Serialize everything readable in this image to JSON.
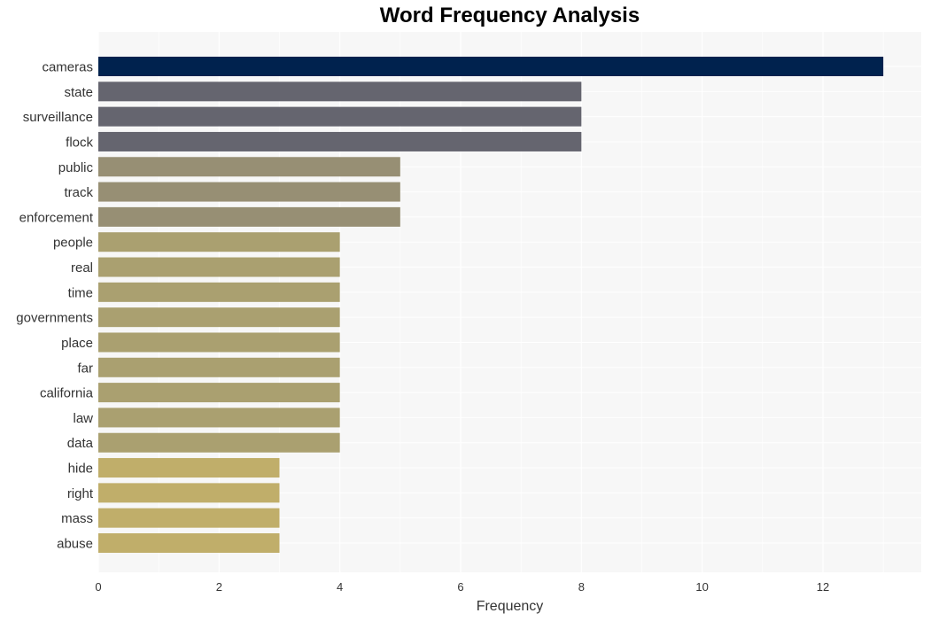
{
  "chart_data": {
    "type": "bar",
    "orientation": "horizontal",
    "title": "Word Frequency Analysis",
    "xlabel": "Frequency",
    "ylabel": "",
    "xlim": [
      0,
      13.6
    ],
    "xticks": [
      0,
      2,
      4,
      6,
      8,
      10,
      12
    ],
    "grid": true,
    "categories": [
      "cameras",
      "state",
      "surveillance",
      "flock",
      "public",
      "track",
      "enforcement",
      "people",
      "real",
      "time",
      "governments",
      "place",
      "far",
      "california",
      "law",
      "data",
      "hide",
      "right",
      "mass",
      "abuse"
    ],
    "values": [
      13,
      8,
      8,
      8,
      5,
      5,
      5,
      4,
      4,
      4,
      4,
      4,
      4,
      4,
      4,
      4,
      3,
      3,
      3,
      3
    ],
    "colors": [
      "#00224e",
      "#65656f",
      "#65656f",
      "#65656f",
      "#978f74",
      "#978f74",
      "#978f74",
      "#aaa070",
      "#aaa070",
      "#aaa070",
      "#aaa070",
      "#aaa070",
      "#aaa070",
      "#aaa070",
      "#aaa070",
      "#aaa070",
      "#c0ae6a",
      "#c0ae6a",
      "#c0ae6a",
      "#c0ae6a"
    ],
    "background": "#f7f7f7"
  }
}
